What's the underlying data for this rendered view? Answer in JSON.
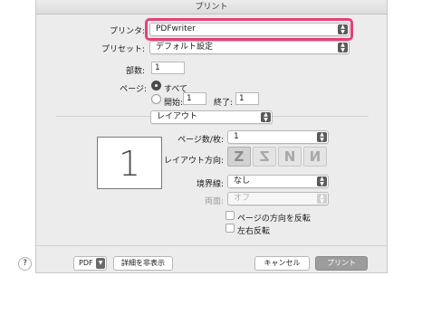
{
  "window": {
    "title": "プリント"
  },
  "printer": {
    "label": "プリンタ:",
    "value": "PDFwriter"
  },
  "presets": {
    "label": "プリセット:",
    "value": "デフォルト設定"
  },
  "copies": {
    "label": "部数:",
    "value": "1"
  },
  "pages": {
    "label": "ページ:",
    "all_label": "すべて",
    "from_label": "開始:",
    "from_value": "1",
    "to_label": "終了:",
    "to_value": "1"
  },
  "section_popup": {
    "value": "レイアウト"
  },
  "preview": {
    "page_number": "1"
  },
  "layout": {
    "pages_per_sheet_label": "ページ数/枚:",
    "pages_per_sheet_value": "1",
    "direction_label": "レイアウト方向:",
    "direction_options": [
      "Z",
      "Z",
      "N",
      "N"
    ],
    "border_label": "境界線:",
    "border_value": "なし",
    "two_sided_label": "両面:",
    "two_sided_value": "オフ",
    "reverse_orientation_label": "ページの方向を反転",
    "flip_horizontal_label": "左右反転"
  },
  "footer": {
    "help_label": "?",
    "pdf_label": "PDF",
    "hide_details_label": "詳細を非表示",
    "cancel_label": "キャンセル",
    "print_label": "プリント"
  },
  "colors": {
    "focus_ring": "#e7407a",
    "dialog_bg": "#ececec"
  }
}
